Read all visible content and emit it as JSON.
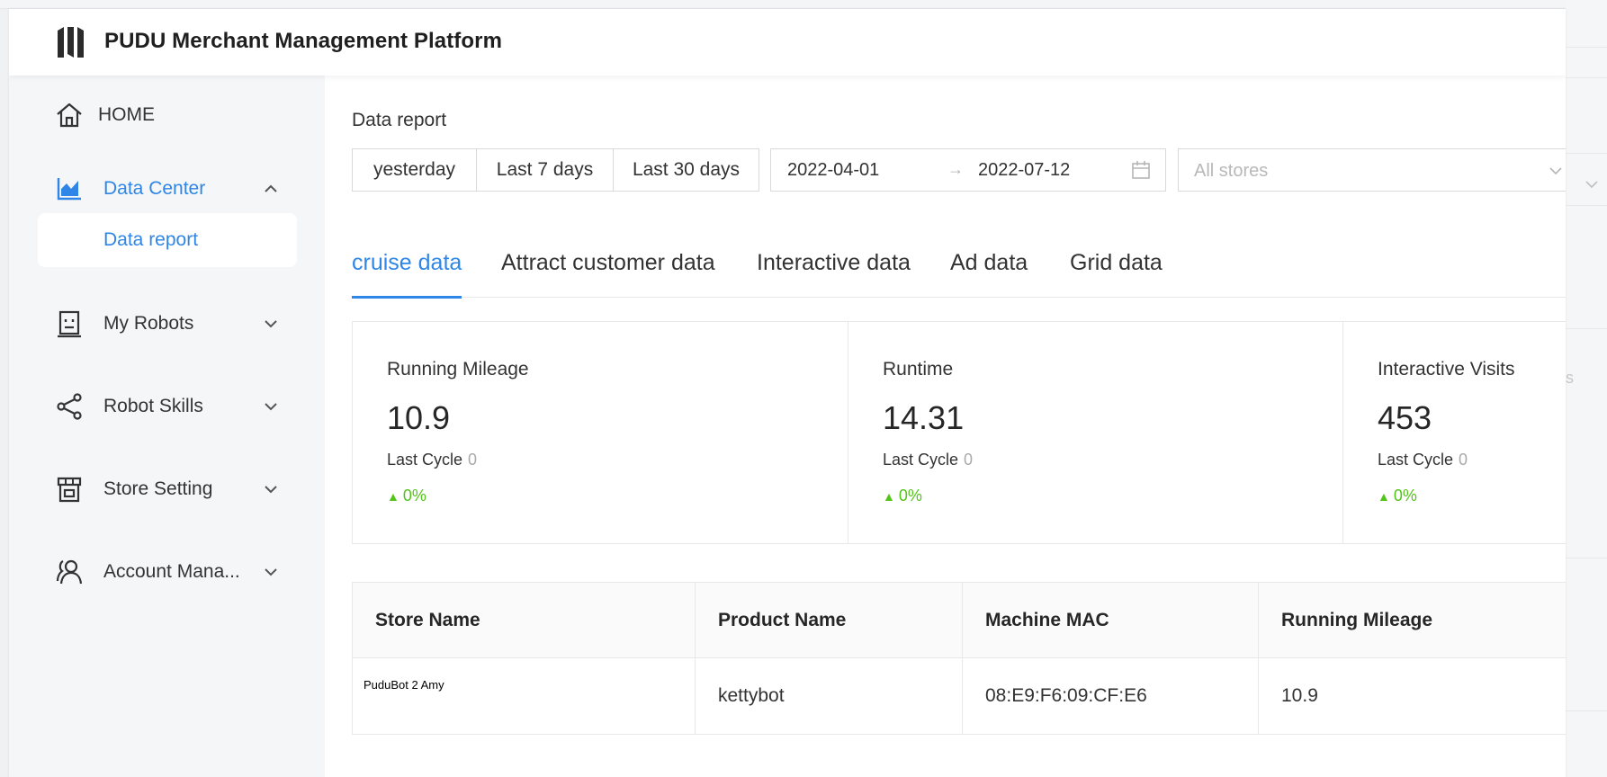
{
  "app": {
    "title": "PUDU Merchant Management Platform"
  },
  "sidebar": {
    "items": [
      {
        "label": "HOME",
        "icon": "home-icon",
        "active": false
      },
      {
        "label": "Data Center",
        "icon": "area-chart-icon",
        "active": true,
        "expanded": true
      },
      {
        "label": "My Robots",
        "icon": "robot-icon",
        "active": false
      },
      {
        "label": "Robot Skills",
        "icon": "share-icon",
        "active": false
      },
      {
        "label": "Store Setting",
        "icon": "store-icon",
        "active": false
      },
      {
        "label": "Account Mana...",
        "icon": "users-icon",
        "active": false
      }
    ],
    "sub_item": {
      "label": "Data report"
    }
  },
  "page": {
    "title": "Data report"
  },
  "filters": {
    "quick_ranges": [
      "yesterday",
      "Last 7 days",
      "Last 30 days"
    ],
    "date_start": "2022-04-01",
    "date_end": "2022-07-12",
    "range_separator": "→",
    "store_placeholder": "All stores"
  },
  "tabs": [
    {
      "label": "cruise data",
      "active": true
    },
    {
      "label": "Attract customer data",
      "active": false
    },
    {
      "label": "Interactive data",
      "active": false
    },
    {
      "label": "Ad data",
      "active": false
    },
    {
      "label": "Grid data",
      "active": false
    }
  ],
  "stats": [
    {
      "label": "Running Mileage",
      "value": "10.9",
      "prev_label": "Last Cycle",
      "prev_value": "0",
      "change": "0%"
    },
    {
      "label": "Runtime",
      "value": "14.31",
      "prev_label": "Last Cycle",
      "prev_value": "0",
      "change": "0%"
    },
    {
      "label": "Interactive Visits",
      "value": "453",
      "prev_label": "Last Cycle",
      "prev_value": "0",
      "change": "0%"
    }
  ],
  "table": {
    "columns": [
      "Store Name",
      "Product Name",
      "Machine MAC",
      "Running Mileage"
    ],
    "rows": [
      [
        "PuduBot 2 Amy",
        "kettybot",
        "08:E9:F6:09:CF:E6",
        "10.9"
      ]
    ]
  },
  "clipped_text": "s",
  "colors": {
    "accent": "#2f86e6",
    "positive": "#52c41a",
    "sidebar_bg": "#f5f6f8"
  }
}
